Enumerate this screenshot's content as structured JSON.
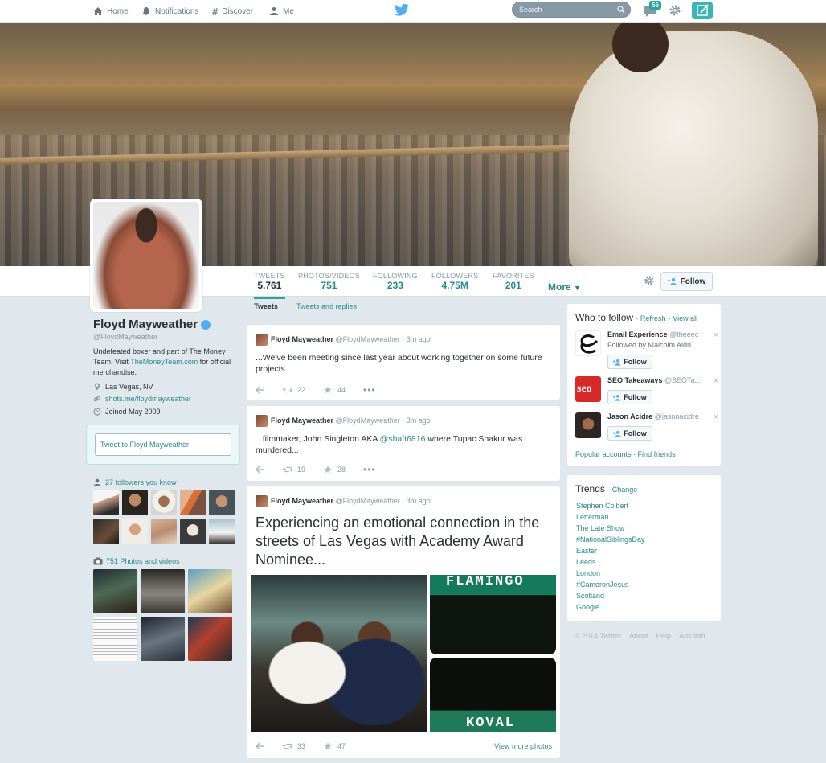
{
  "nav": {
    "home": "Home",
    "notifications": "Notifications",
    "discover": "Discover",
    "me": "Me",
    "search_placeholder": "Search",
    "messages_count": "56"
  },
  "profile": {
    "name": "Floyd Mayweather",
    "handle": "@FloydMayweather",
    "bio_1": "Undefeated boxer and part of The Money Team. Visit",
    "bio_link": "TheMoneyTeam.com",
    "bio_2": "for official merchandise.",
    "location": "Las Vegas, NV",
    "website": "shots.me/floydmayweather",
    "joined": "Joined May 2009",
    "tweet_to_placeholder": "Tweet to Floyd Mayweather",
    "followers_you_know": "27 followers you know",
    "photos_videos": "751 Photos and videos"
  },
  "stats": [
    {
      "label": "TWEETS",
      "value": "5,761"
    },
    {
      "label": "PHOTOS/VIDEOS",
      "value": "751"
    },
    {
      "label": "FOLLOWING",
      "value": "233"
    },
    {
      "label": "FOLLOWERS",
      "value": "4.75M"
    },
    {
      "label": "FAVORITES",
      "value": "201"
    }
  ],
  "more_label": "More",
  "follow_label": "Follow",
  "timeline": {
    "tab_tweets": "Tweets",
    "tab_replies": "Tweets and replies",
    "tweets": [
      {
        "name": "Floyd Mayweather",
        "handle": "@FloydMayweather",
        "time": "· 3m ago",
        "text": "...We've been meeting since last year about working together on some future projects.",
        "retweets": "22",
        "favorites": "44"
      },
      {
        "name": "Floyd Mayweather",
        "handle": "@FloydMayweather",
        "time": "· 3m ago",
        "text_a": "...filmmaker, John Singleton AKA",
        "mention": "@shaft6816",
        "text_b": "where Tupac Shakur was murdered...",
        "retweets": "19",
        "favorites": "28"
      },
      {
        "name": "Floyd Mayweather",
        "handle": "@FloydMayweather",
        "time": "· 3m ago",
        "text": "Experiencing an emotional connection in the streets of Las Vegas with Academy Award Nominee...",
        "media_sign_1": "FLAMINGO",
        "media_sign_2": "KOVAL",
        "retweets": "33",
        "favorites": "47",
        "view_more": "View more photos"
      }
    ]
  },
  "who_to_follow": {
    "title": "Who to follow",
    "refresh": "· Refresh",
    "view_all": "· View all",
    "users": [
      {
        "name": "Email Experience",
        "handle": "@theeec",
        "sub": "Followed by Malcolm Aldri...",
        "follow": "Follow",
        "avatar_color": "#ffffff"
      },
      {
        "name": "SEO Takeaways",
        "handle": "@SEOTa...",
        "sub": "",
        "follow": "Follow",
        "avatar_color": "#d62a2a"
      },
      {
        "name": "Jason Acidre",
        "handle": "@jasonacidre",
        "sub": "",
        "follow": "Follow",
        "avatar_color": "#3a3028"
      }
    ],
    "popular": "Popular accounts",
    "find_friends": "· Find friends"
  },
  "trends": {
    "title": "Trends",
    "change": "· Change",
    "items": [
      "Stephen Colbert",
      "Letterman",
      "The Late Show",
      "#NationalSiblingsDay",
      "Easter",
      "Leeds",
      "London",
      "#CameronJesus",
      "Scotland",
      "Google"
    ]
  },
  "footer": {
    "copyright": "© 2014 Twitter",
    "about": "About",
    "help": "Help",
    "ads": "Ads info"
  },
  "colors": {
    "accent": "#2aa3a3",
    "link": "#2a8a8a"
  }
}
